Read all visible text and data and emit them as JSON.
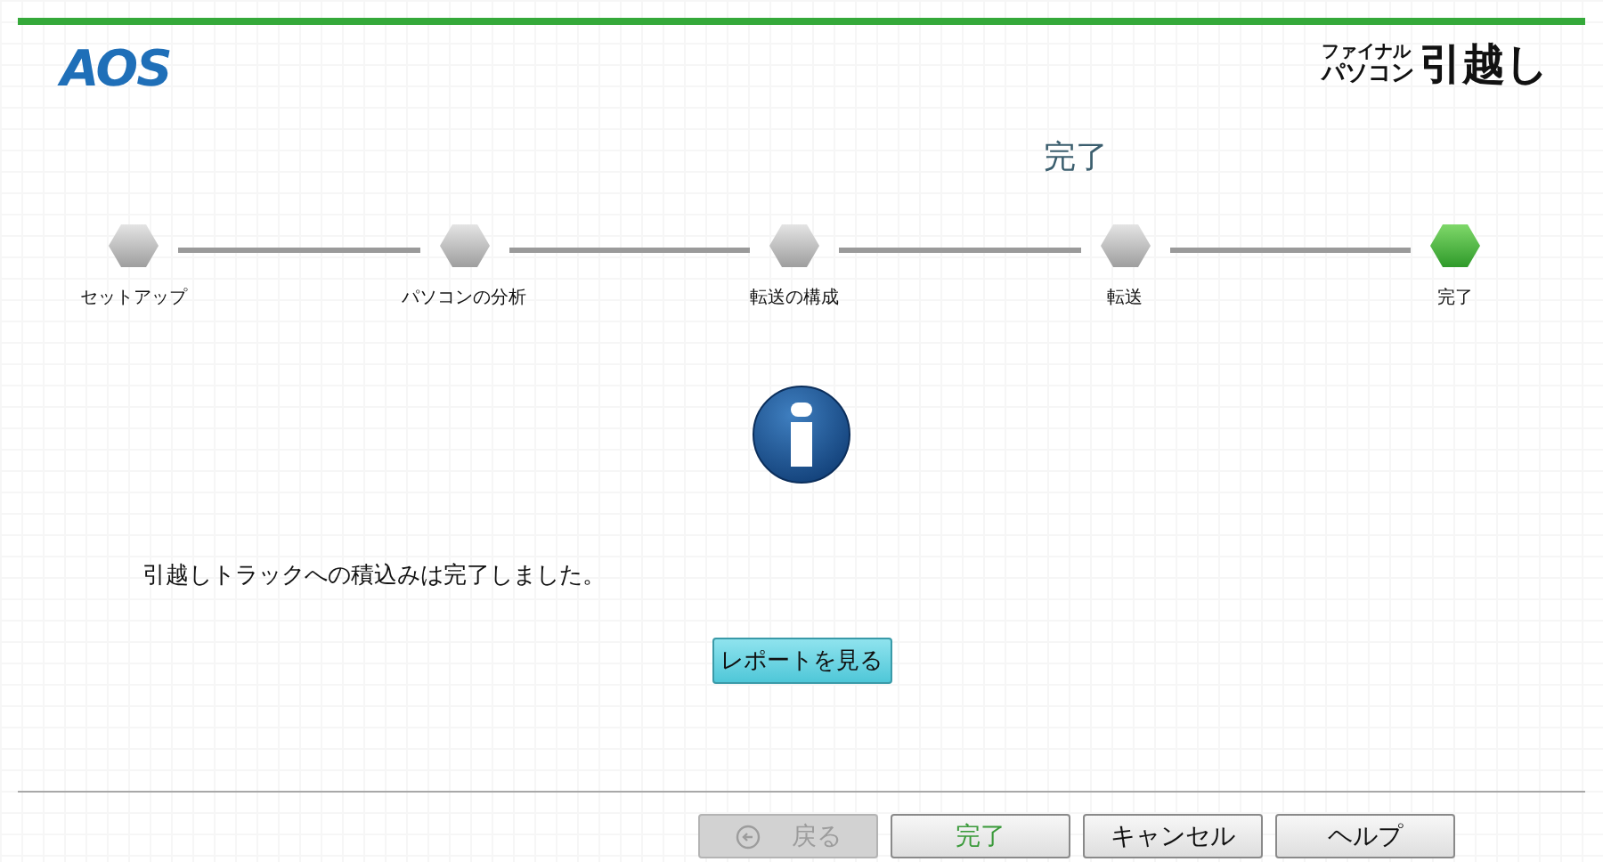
{
  "header": {
    "logo": "AOS",
    "product_small": "ファイナル",
    "product_mid": "パソコン",
    "product_big": "引越し"
  },
  "title": "完了",
  "steps": [
    {
      "label": "セットアップ",
      "selected": false
    },
    {
      "label": "パソコンの分析",
      "selected": false
    },
    {
      "label": "転送の構成",
      "selected": false
    },
    {
      "label": "転送",
      "selected": false
    },
    {
      "label": "完了",
      "selected": true
    }
  ],
  "message": "引越しトラックへの積込みは完了しました。",
  "report_button": "レポートを見る",
  "buttons": [
    {
      "label": "戻る",
      "kind": "back",
      "disabled": true
    },
    {
      "label": "完了",
      "kind": "primary",
      "disabled": false
    },
    {
      "label": "キャンセル",
      "kind": "normal",
      "disabled": false
    },
    {
      "label": "ヘルプ",
      "kind": "normal",
      "disabled": false
    }
  ]
}
